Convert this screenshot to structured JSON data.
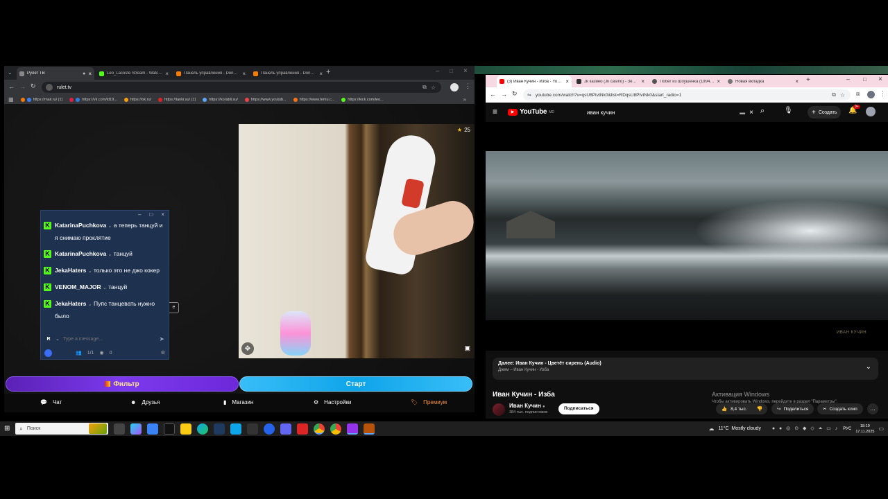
{
  "left_browser": {
    "tabs": [
      {
        "title": "Рулет ТВ",
        "active": true
      },
      {
        "title": "Leo_Lacoste Stream - Watch Li"
      },
      {
        "title": "Панель управления - Donatio"
      },
      {
        "title": "Панель управления - Donatio"
      }
    ],
    "url": "rulet.tv",
    "bookmarks": [
      "https://mail.ru/ (1)",
      "https://vk.com/id19...",
      "https://ok.ru/",
      "https://tanki.su/ (1)",
      "https://korabli.su/",
      "https://www.youtub...",
      "https://www.temu.c...",
      "https://kick.com/leo..."
    ]
  },
  "stream": {
    "star_count": "25"
  },
  "chat": {
    "messages": [
      {
        "user": "KatarinaPuchkova",
        "text": "а теперь танцуй и я снимаю проклятие"
      },
      {
        "user": "KatarinaPuchkova",
        "text": "танцуй"
      },
      {
        "user": "JekaHaters",
        "text": "только это не джо кокер"
      },
      {
        "user": "VENOM_MAJOR",
        "text": "танцуй"
      },
      {
        "user": "JekaHaters",
        "text": "Пупс танцевать нужно было"
      }
    ],
    "input_placeholder": "Type a message...",
    "avatar_letter": "R",
    "count_left": "1/1",
    "count_views": "0",
    "hidden_fragment": "e"
  },
  "buttons": {
    "filter": "Фильтр",
    "start": "Старт"
  },
  "bottom_nav": {
    "chat": "Чат",
    "friends": "Друзья",
    "shop": "Магазин",
    "settings": "Настройки",
    "premium": "Премиум"
  },
  "right_browser": {
    "tabs": [
      {
        "title": "(3) Иван Кучин - Изба - YouTu",
        "active": true
      },
      {
        "title": "Jk казино (Jk casino) - Зеркал"
      },
      {
        "title": "Побег из Шоушенка (1994) сл"
      },
      {
        "title": "Новая вкладка"
      }
    ],
    "url": "youtube.com/watch?v=qsU8PtvtNk0&list=RDqsU8PtvtNk0&start_radio=1"
  },
  "youtube": {
    "logo_text": "YouTube",
    "logo_sup": "MD",
    "search_value": "иван кучин",
    "create_label": "Создать",
    "notif_count": "9+",
    "watermark": "ИВАН КУЧИН",
    "next_up": "Далее: Иван Кучин - Цветёт сирень (Audio)",
    "next_sub": "Джем – Иван Кучин - Изба",
    "video_title": "Иван Кучин - Изба",
    "channel_name": "Иван Кучин",
    "subscribers": "384 тыс. подписчиков",
    "subscribe_label": "Подписаться",
    "likes": "8,4 тыс.",
    "share_label": "Поделиться",
    "clip_label": "Создать клип",
    "activation_title": "Активация Windows",
    "activation_sub": "Чтобы активировать Windows, перейдите в раздел \"Параметры\"."
  },
  "taskbar": {
    "search_placeholder": "Поиск",
    "weather": "11°C  Mostly cloudy",
    "lang": "РУС",
    "time": "18:19",
    "date": "17.11.2025"
  }
}
